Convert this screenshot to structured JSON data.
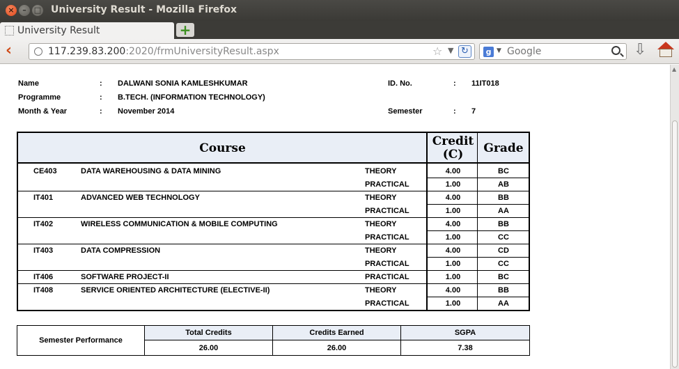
{
  "window": {
    "title": "University Result - Mozilla Firefox"
  },
  "tab": {
    "label": "University Result",
    "new_tab": "+"
  },
  "nav": {
    "url_host": "117.239.83.200",
    "url_rest": ":2020/frmUniversityResult.aspx",
    "search_placeholder": "Google"
  },
  "student": {
    "name_label": "Name",
    "name_value": "DALWANI SONIA KAMLESHKUMAR",
    "programme_label": "Programme",
    "programme_value": "B.TECH. (INFORMATION TECHNOLOGY)",
    "month_label": "Month & Year",
    "month_value": "November 2014",
    "id_label": "ID. No.",
    "id_value": "11IT018",
    "semester_label": "Semester",
    "semester_value": "7",
    "separator": ":"
  },
  "result_table": {
    "headers": {
      "course": "Course",
      "credit_1": "Credit",
      "credit_2": "(C)",
      "grade": "Grade"
    },
    "rows": [
      {
        "code": "CE403",
        "name": "DATA WAREHOUSING & DATA MINING",
        "type": "THEORY",
        "credit": "4.00",
        "grade": "BC"
      },
      {
        "code": "",
        "name": "",
        "type": "PRACTICAL",
        "credit": "1.00",
        "grade": "AB"
      },
      {
        "code": "IT401",
        "name": "ADVANCED WEB TECHNOLOGY",
        "type": "THEORY",
        "credit": "4.00",
        "grade": "BB"
      },
      {
        "code": "",
        "name": "",
        "type": "PRACTICAL",
        "credit": "1.00",
        "grade": "AA"
      },
      {
        "code": "IT402",
        "name": "WIRELESS COMMUNICATION & MOBILE COMPUTING",
        "type": "THEORY",
        "credit": "4.00",
        "grade": "BB"
      },
      {
        "code": "",
        "name": "",
        "type": "PRACTICAL",
        "credit": "1.00",
        "grade": "CC"
      },
      {
        "code": "IT403",
        "name": "DATA COMPRESSION",
        "type": "THEORY",
        "credit": "4.00",
        "grade": "CD"
      },
      {
        "code": "",
        "name": "",
        "type": "PRACTICAL",
        "credit": "1.00",
        "grade": "CC"
      },
      {
        "code": "IT406",
        "name": "SOFTWARE PROJECT-II",
        "type": "PRACTICAL",
        "credit": "1.00",
        "grade": "BC"
      },
      {
        "code": "IT408",
        "name": "SERVICE ORIENTED ARCHITECTURE (ELECTIVE-II)",
        "type": "THEORY",
        "credit": "4.00",
        "grade": "BB"
      },
      {
        "code": "",
        "name": "",
        "type": "PRACTICAL",
        "credit": "1.00",
        "grade": "AA"
      }
    ]
  },
  "performance": {
    "label": "Semester Performance",
    "total_credits_label": "Total Credits",
    "total_credits": "26.00",
    "credits_earned_label": "Credits Earned",
    "credits_earned": "26.00",
    "sgpa_label": "SGPA",
    "sgpa": "7.38"
  },
  "colors": {
    "header_bg": "#e9eef6",
    "titlebar": "#3b3a36",
    "close_button": "#e0461a"
  }
}
